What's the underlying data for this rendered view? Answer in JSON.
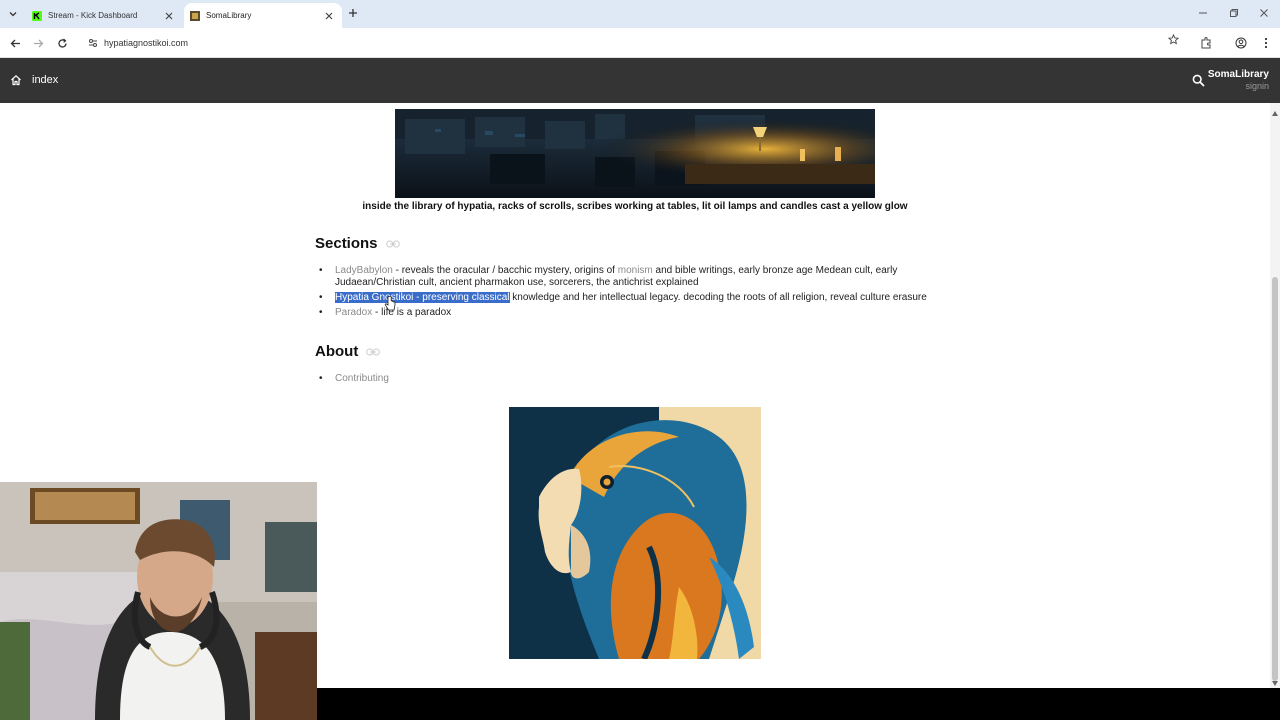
{
  "browser": {
    "tabs": [
      {
        "title": "Stream - Kick Dashboard",
        "active": false,
        "favicon_color": "#53fc18"
      },
      {
        "title": "SomaLibrary",
        "active": true
      }
    ],
    "url": "hypatiagnostikoi.com"
  },
  "site_header": {
    "nav_label": "index",
    "brand": "SomaLibrary",
    "signin": "signin"
  },
  "banner": {
    "caption": "inside the library of hypatia, racks of scrolls, scribes working at tables, lit oil lamps and candles cast a yellow glow"
  },
  "sections": {
    "heading": "Sections",
    "items": [
      {
        "link": "LadyBabylon",
        "text_a": " - reveals the oracular / bacchic mystery, origins of ",
        "link2": "monism",
        "text_b": " and bible writings, early bronze age Medean cult, early Judaean/Christian cult, ancient pharmakon use, sorcerers, the antichrist explained"
      },
      {
        "highlight": "Hypatia Gnostikoi - preserving classical",
        "text": " knowledge and her intellectual legacy. decoding the roots of all religion, reveal culture erasure"
      },
      {
        "link": "Paradox",
        "text": " - life is a paradox"
      }
    ]
  },
  "about": {
    "heading": "About",
    "items": [
      "Contributing"
    ]
  },
  "colors": {
    "header_bg": "#343434",
    "selection": "#3a6dc9",
    "link": "#8a8a8a"
  }
}
